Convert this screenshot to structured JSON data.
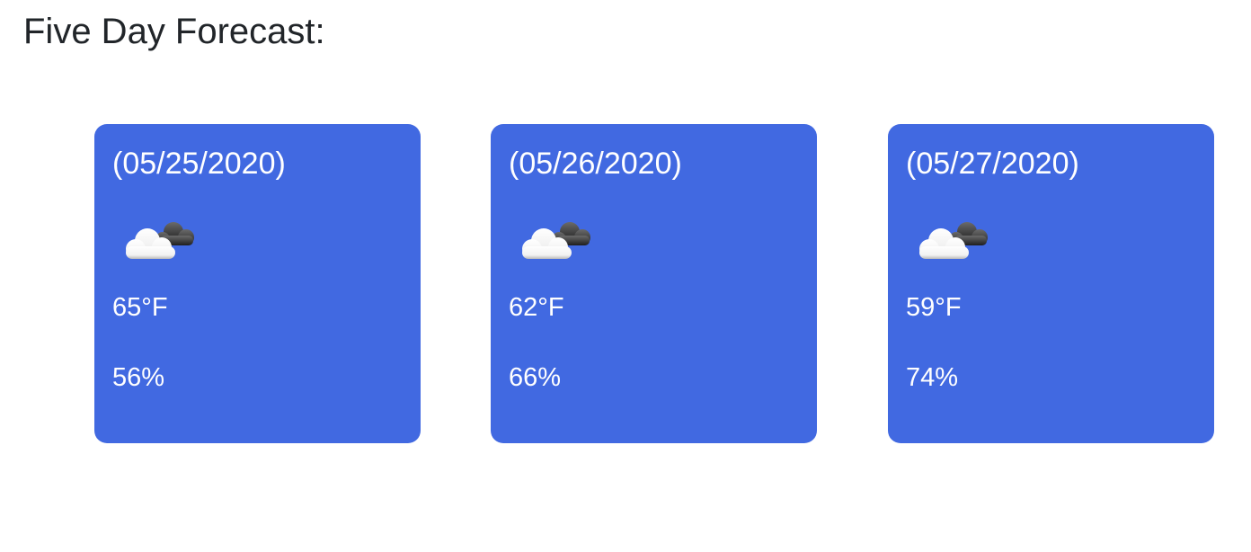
{
  "header": {
    "title": "Five Day Forecast:"
  },
  "forecast": [
    {
      "date": "(05/25/2020)",
      "icon": "partly-cloudy-icon",
      "temperature": "65°F",
      "humidity": "56%"
    },
    {
      "date": "(05/26/2020)",
      "icon": "partly-cloudy-icon",
      "temperature": "62°F",
      "humidity": "66%"
    },
    {
      "date": "(05/27/2020)",
      "icon": "partly-cloudy-icon",
      "temperature": "59°F",
      "humidity": "74%"
    }
  ],
  "colors": {
    "card_background": "#4169e1",
    "card_text": "#ffffff",
    "title_text": "#212529"
  }
}
